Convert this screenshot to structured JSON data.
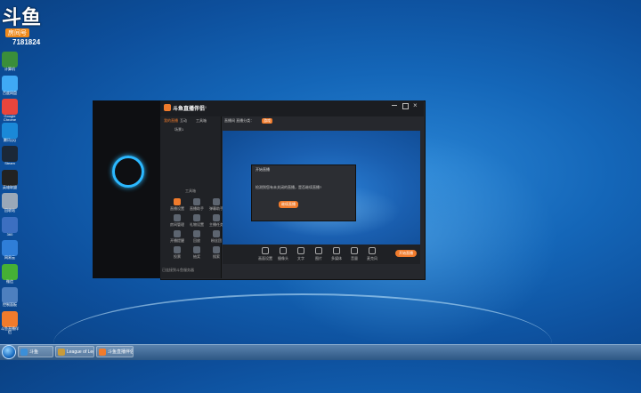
{
  "watermark": {
    "logo": "斗鱼",
    "room_label": "房间号",
    "room_number": "7181824"
  },
  "app": {
    "title": "斗鱼直播伴侣",
    "version": "V6.0",
    "tabs": [
      "我的直播",
      "互动",
      "工具箱"
    ],
    "scene_title": "场景",
    "scene_name": "场景1",
    "panel_caption": "工具箱",
    "tools": [
      {
        "label": "直播设置",
        "icon": "gear-icon",
        "color": "#f07b2c"
      },
      {
        "label": "直播助手",
        "icon": "assistant-icon",
        "color": "#5d6570"
      },
      {
        "label": "弹幕助手",
        "icon": "danmaku-icon",
        "color": "#5d6570"
      },
      {
        "label": "房间管理",
        "icon": "room-icon",
        "color": "#5d6570"
      },
      {
        "label": "礼物设置",
        "icon": "gift-icon",
        "color": "#5d6570"
      },
      {
        "label": "主播任务",
        "icon": "task-icon",
        "color": "#5d6570"
      },
      {
        "label": "开播提醒",
        "icon": "bell-icon",
        "color": "#5d6570"
      },
      {
        "label": "回放",
        "icon": "replay-icon",
        "color": "#5d6570"
      },
      {
        "label": "粉丝团",
        "icon": "fans-icon",
        "color": "#5d6570"
      },
      {
        "label": "投票",
        "icon": "vote-icon",
        "color": "#5d6570"
      },
      {
        "label": "抽奖",
        "icon": "lottery-icon",
        "color": "#5d6570"
      },
      {
        "label": "搜索",
        "icon": "search-icon",
        "color": "#5d6570"
      }
    ],
    "preview_header": "直播间 直播分类：",
    "preview_tag": "游戏",
    "controls": [
      {
        "label": "画面设置",
        "icon": "screen-icon"
      },
      {
        "label": "摄像头",
        "icon": "camera-icon"
      },
      {
        "label": "文字"
      },
      {
        "label": "图片"
      },
      {
        "label": "多媒体"
      },
      {
        "label": "音量",
        "icon": "volume-icon"
      },
      {
        "label": "麦克风",
        "icon": "mic-icon"
      }
    ],
    "start_button": "开始直播",
    "dialog": {
      "title": "开始直播",
      "line1": "检测到您有未关闭的直播，是否继续直播?",
      "line2": "",
      "button": "继续直播"
    },
    "footer": "已连接到斗鱼服务器"
  },
  "taskbar": {
    "items": [
      {
        "label": "斗鱼",
        "color": "#3b8fd9"
      },
      {
        "label": "League of Legends",
        "color": "#c79b3b"
      },
      {
        "label": "斗鱼直播伴侣",
        "color": "#f07b2c"
      }
    ]
  },
  "desktop_icons": [
    {
      "label": "计算机",
      "color": "#3a8e3a"
    },
    {
      "label": "百度网盘",
      "color": "#3fa9f5"
    },
    {
      "label": "Google Chrome",
      "color": "#e8453c"
    },
    {
      "label": "腾讯QQ",
      "color": "#1a89d8"
    },
    {
      "label": "Steam",
      "color": "#1b2838"
    },
    {
      "label": "英雄联盟",
      "color": "#222222"
    },
    {
      "label": "回收站",
      "color": "#9aa8b8"
    },
    {
      "label": "360",
      "color": "#3c6fc1"
    },
    {
      "label": "网易云",
      "color": "#2f7ed8"
    },
    {
      "label": "微信",
      "color": "#45b035"
    },
    {
      "label": "控制面板",
      "color": "#4d7fbf"
    },
    {
      "label": "斗鱼直播伴侣",
      "color": "#f07b2c"
    }
  ]
}
